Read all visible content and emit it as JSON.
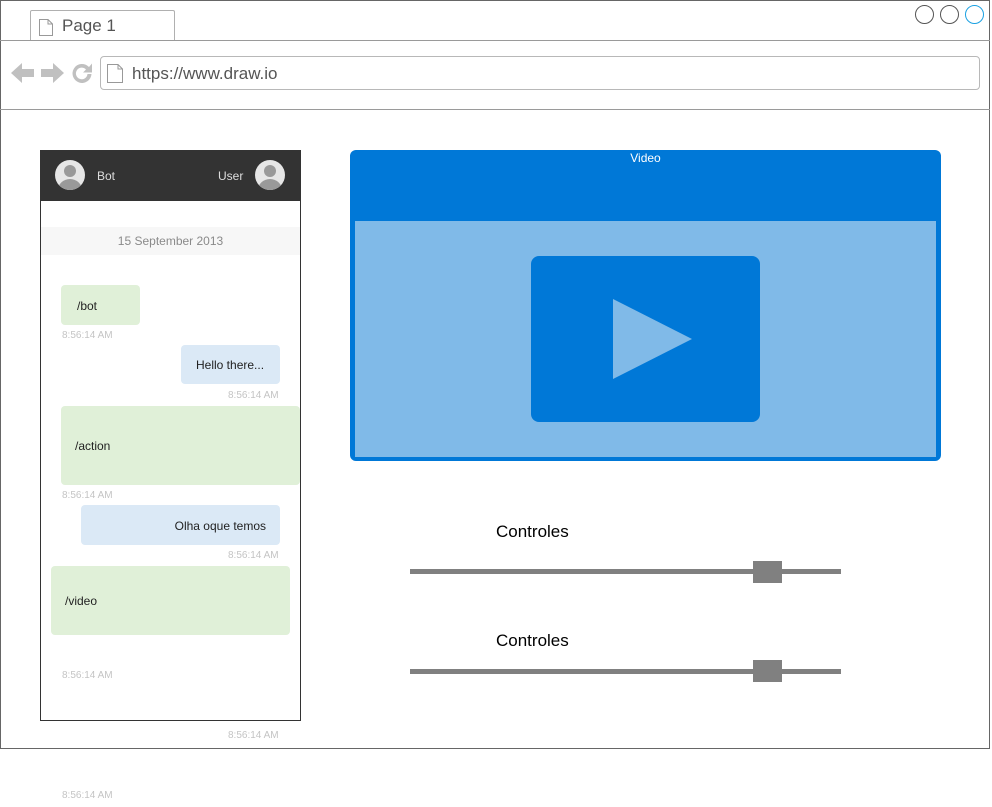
{
  "browser": {
    "tab_title": "Page 1",
    "url": "https://www.draw.io"
  },
  "chat": {
    "bot_name": "Bot",
    "user_name": "User",
    "date": "15 September 2013",
    "messages": [
      {
        "side": "bot",
        "text": "/bot",
        "time": "8:56:14 AM"
      },
      {
        "side": "user",
        "text": "Hello there...",
        "time": "8:56:14 AM"
      },
      {
        "side": "bot",
        "text": "/action",
        "time": "8:56:14 AM"
      },
      {
        "side": "user",
        "text": "Olha oque temos",
        "time": "8:56:14 AM"
      },
      {
        "side": "bot",
        "text": "/video",
        "time": "8:56:14 AM"
      }
    ],
    "extra_times": [
      "8:56:14 AM",
      "8:56:14 AM"
    ]
  },
  "video": {
    "title": "Video"
  },
  "controls": [
    {
      "label": "Controles",
      "value_percent": 83
    },
    {
      "label": "Controles",
      "value_percent": 83
    }
  ],
  "colors": {
    "header_bg": "#333333",
    "video_blue": "#0078d7",
    "video_light": "#80bae8",
    "bot_bubble": "#e0f0d8",
    "user_bubble": "#dbe9f6",
    "slider_gray": "#808080"
  },
  "icons": {
    "back": "arrow-left-icon",
    "forward": "arrow-right-icon",
    "reload": "reload-icon",
    "page": "page-icon",
    "avatar": "user-avatar-icon",
    "play": "play-icon"
  }
}
